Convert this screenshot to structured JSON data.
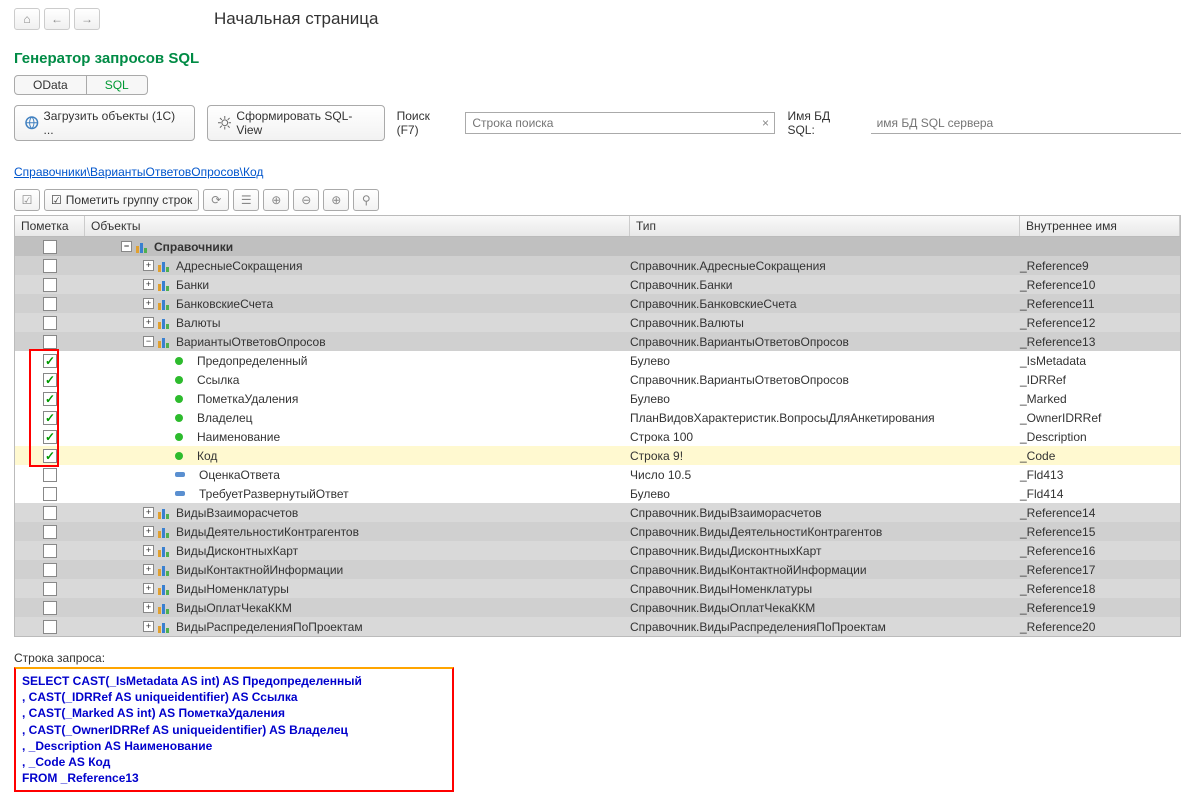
{
  "nav": {
    "home": "⌂",
    "back": "←",
    "forward": "→"
  },
  "page_title": "Начальная страница",
  "app_title": "Генератор запросов SQL",
  "tabs": {
    "odata": "OData",
    "sql": "SQL"
  },
  "toolbar": {
    "load_objects": "Загрузить объекты (1С) ...",
    "form_sql_view": "Сформировать SQL-View",
    "search_label": "Поиск (F7)",
    "search_placeholder": "Строка поиска",
    "db_label": "Имя БД SQL:",
    "db_placeholder": "имя БД SQL сервера"
  },
  "breadcrumb": "Справочники\\ВариантыОтветовОпросов\\Код",
  "grid_toolbar": {
    "mark_group": "Пометить группу строк"
  },
  "columns": {
    "mark": "Пометка",
    "objects": "Объекты",
    "type": "Тип",
    "iname": "Внутреннее имя"
  },
  "root": {
    "label": "Справочники"
  },
  "rows": [
    {
      "kind": "lvl1",
      "expand": "+",
      "label": "АдресныеСокращения",
      "type": "Справочник.АдресныеСокращения",
      "iname": "_Reference9"
    },
    {
      "kind": "lvl1",
      "expand": "+",
      "label": "Банки",
      "type": "Справочник.Банки",
      "iname": "_Reference10"
    },
    {
      "kind": "lvl1",
      "expand": "+",
      "label": "БанковскиеСчета",
      "type": "Справочник.БанковскиеСчета",
      "iname": "_Reference11"
    },
    {
      "kind": "lvl1",
      "expand": "+",
      "label": "Валюты",
      "type": "Справочник.Валюты",
      "iname": "_Reference12"
    },
    {
      "kind": "lvl1",
      "expand": "−",
      "label": "ВариантыОтветовОпросов",
      "type": "Справочник.ВариантыОтветовОпросов",
      "iname": "_Reference13"
    },
    {
      "kind": "lvl2",
      "checked": true,
      "dot": "green",
      "label": "Предопределенный",
      "type": "Булево",
      "iname": "_IsMetadata"
    },
    {
      "kind": "lvl2",
      "checked": true,
      "dot": "green",
      "label": "Ссылка",
      "type": "Справочник.ВариантыОтветовОпросов",
      "iname": "_IDRRef"
    },
    {
      "kind": "lvl2",
      "checked": true,
      "dot": "green",
      "label": "ПометкаУдаления",
      "type": "Булево",
      "iname": "_Marked"
    },
    {
      "kind": "lvl2",
      "checked": true,
      "dot": "green",
      "label": "Владелец",
      "type": "ПланВидовХарактеристик.ВопросыДляАнкетирования",
      "iname": "_OwnerIDRRef"
    },
    {
      "kind": "lvl2",
      "checked": true,
      "dot": "green",
      "label": "Наименование",
      "type": "Строка 100",
      "iname": "_Description"
    },
    {
      "kind": "lvl2",
      "checked": true,
      "highlight": true,
      "dot": "green",
      "label": "Код",
      "type": "Строка 9!",
      "iname": "_Code"
    },
    {
      "kind": "lvl2",
      "checked": false,
      "dot": "blue",
      "label": "ОценкаОтвета",
      "type": "Число 10.5",
      "iname": "_Fld413"
    },
    {
      "kind": "lvl2",
      "checked": false,
      "dot": "blue",
      "label": "ТребуетРазвернутыйОтвет",
      "type": "Булево",
      "iname": "_Fld414"
    },
    {
      "kind": "lvl1",
      "expand": "+",
      "label": "ВидыВзаиморасчетов",
      "type": "Справочник.ВидыВзаиморасчетов",
      "iname": "_Reference14"
    },
    {
      "kind": "lvl1",
      "expand": "+",
      "label": "ВидыДеятельностиКонтрагентов",
      "type": "Справочник.ВидыДеятельностиКонтрагентов",
      "iname": "_Reference15"
    },
    {
      "kind": "lvl1",
      "expand": "+",
      "label": "ВидыДисконтныхКарт",
      "type": "Справочник.ВидыДисконтныхКарт",
      "iname": "_Reference16"
    },
    {
      "kind": "lvl1",
      "expand": "+",
      "label": "ВидыКонтактнойИнформации",
      "type": "Справочник.ВидыКонтактнойИнформации",
      "iname": "_Reference17"
    },
    {
      "kind": "lvl1",
      "expand": "+",
      "label": "ВидыНоменклатуры",
      "type": "Справочник.ВидыНоменклатуры",
      "iname": "_Reference18"
    },
    {
      "kind": "lvl1",
      "expand": "+",
      "label": "ВидыОплатЧекаККМ",
      "type": "Справочник.ВидыОплатЧекаККМ",
      "iname": "_Reference19"
    },
    {
      "kind": "lvl1",
      "expand": "+",
      "label": "ВидыРаспределенияПоПроектам",
      "type": "Справочник.ВидыРаспределенияПоПроектам",
      "iname": "_Reference20"
    }
  ],
  "query_label": "Строка запроса:",
  "query_lines": [
    "SELECT CAST(_IsMetadata AS int) AS Предопределенный",
    ", CAST(_IDRRef AS uniqueidentifier) AS Ссылка",
    ", CAST(_Marked AS int) AS ПометкаУдаления",
    ", CAST(_OwnerIDRRef AS uniqueidentifier) AS Владелец",
    ", _Description AS Наименование",
    ", _Code AS Код",
    "FROM _Reference13"
  ]
}
